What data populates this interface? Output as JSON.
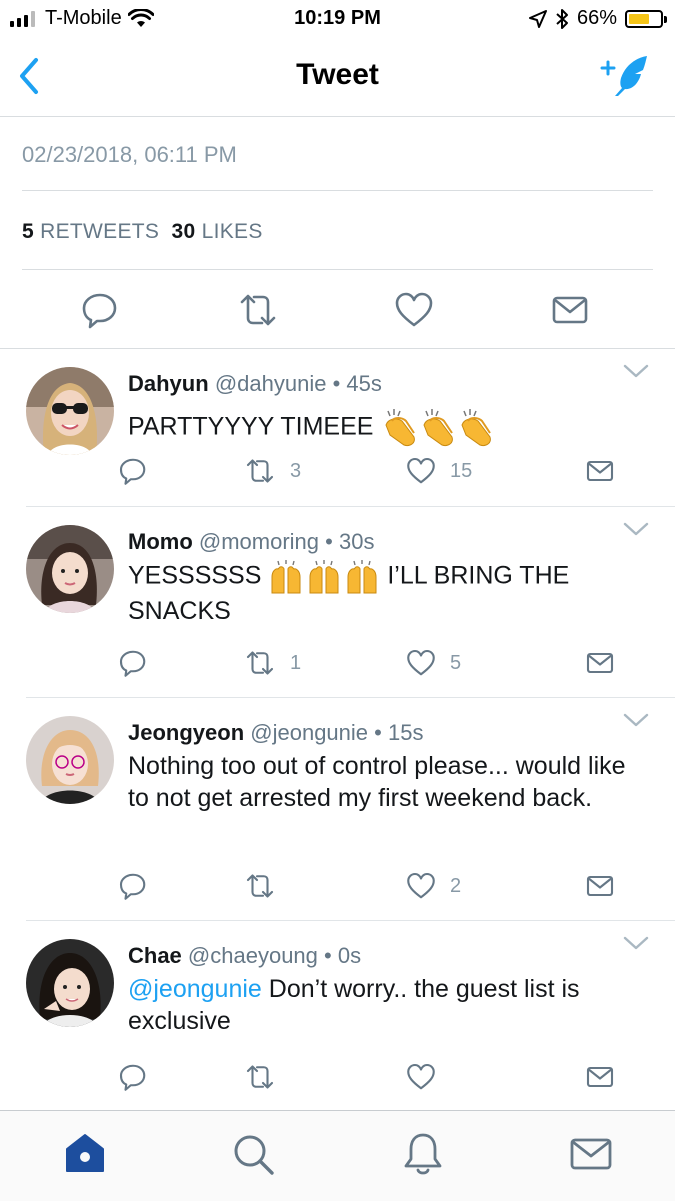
{
  "status_bar": {
    "carrier": "T-Mobile",
    "time": "10:19 PM",
    "battery": "66%",
    "battery_level": 0.66,
    "icons": [
      "signal-icon",
      "wifi-icon",
      "location-icon",
      "bluetooth-icon",
      "battery-icon"
    ]
  },
  "nav": {
    "title": "Tweet",
    "back_icon": "back-chevron-icon",
    "compose_icon": "compose-tweet-icon"
  },
  "tweet": {
    "timestamp": "02/23/2018, 06:11 PM",
    "retweets_count": "5",
    "retweets_label": "RETWEETS",
    "likes_count": "30",
    "likes_label": "LIKES",
    "actions": [
      "reply-icon",
      "retweet-icon",
      "like-icon",
      "message-icon"
    ]
  },
  "replies": [
    {
      "name": "Dahyun",
      "handle": "@dahyunie",
      "time": "45s",
      "text": "PARTTYYYY TIMEEE",
      "emoji": "clapping-hands",
      "retweets": "3",
      "likes": "15"
    },
    {
      "name": "Momo",
      "handle": "@momoring",
      "time": "30s",
      "text_before": "YESSSSSS",
      "text_after": "I’LL BRING THE SNACKS",
      "emoji": "raising-hands",
      "retweets": "1",
      "likes": "5"
    },
    {
      "name": "Jeongyeon",
      "handle": "@jeongunie",
      "time": "15s",
      "text": "Nothing too out of control please... would like to not get arrested my first weekend back.",
      "retweets": "",
      "likes": "2"
    },
    {
      "name": "Chae",
      "handle": "@chaeyoung",
      "time": "0s",
      "mention": "@jeongunie",
      "text": " Don’t worry..  the guest list is exclusive",
      "retweets": "",
      "likes": ""
    }
  ],
  "tab_bar": {
    "tabs": [
      "home-icon",
      "search-icon",
      "notifications-icon",
      "messages-icon"
    ],
    "active": "home-icon"
  },
  "colors": {
    "accent": "#1da1f2",
    "active_tab": "#1d4e9e",
    "secondary_text": "#657786",
    "icon_gray": "#657786",
    "divider": "#d9dde0"
  }
}
